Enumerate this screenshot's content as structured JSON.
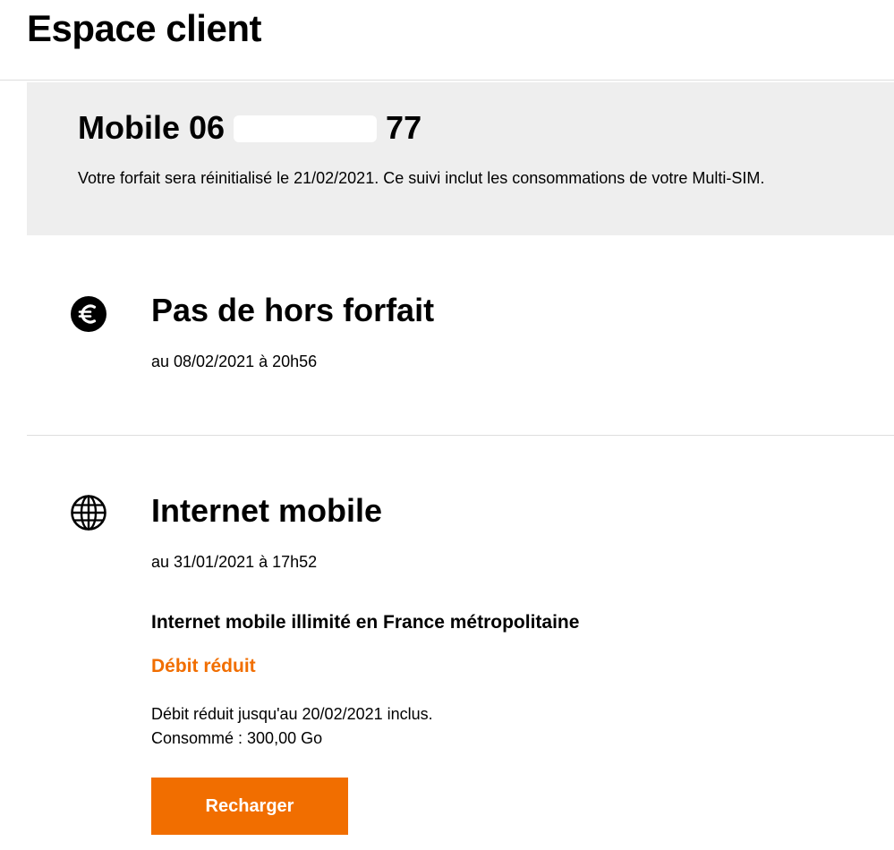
{
  "header": {
    "title": "Espace client"
  },
  "line": {
    "label_prefix": "Mobile 06",
    "label_suffix": "77",
    "description": "Votre forfait sera réinitialisé le 21/02/2021. Ce suivi inclut les consommations de votre Multi-SIM."
  },
  "sections": {
    "overage": {
      "icon": "euro-icon",
      "title": "Pas de hors forfait",
      "date": "au 08/02/2021 à 20h56"
    },
    "internet": {
      "icon": "globe-icon",
      "title": "Internet mobile",
      "date": "au 31/01/2021 à 17h52",
      "plan_name": "Internet mobile illimité en France métropolitaine",
      "status": "Débit réduit",
      "detail_reduced_until": "Débit réduit jusqu'au 20/02/2021 inclus.",
      "detail_consumed": "Consommé : 300,00 Go",
      "button_label": "Recharger"
    }
  },
  "colors": {
    "accent": "#f16e00",
    "card_background": "#eeeeee",
    "divider": "#dddddd"
  }
}
